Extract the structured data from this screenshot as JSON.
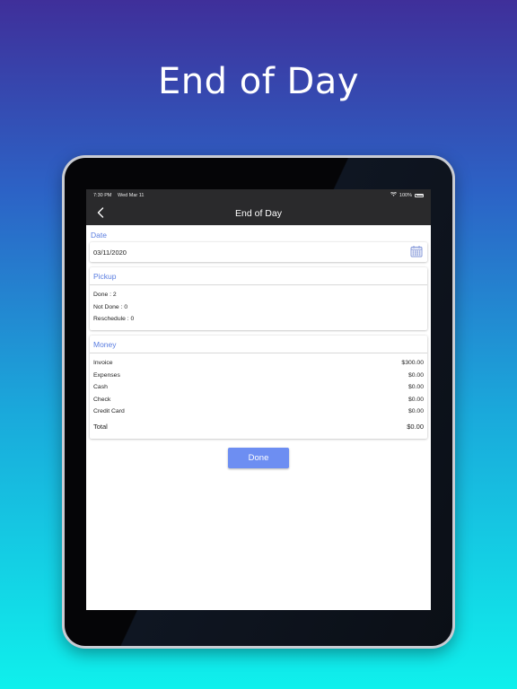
{
  "marketing": {
    "headline": "End of Day"
  },
  "status_bar": {
    "time": "7:30 PM",
    "date": "Wed Mar 11",
    "battery": "100%"
  },
  "nav": {
    "title": "End of Day",
    "back_icon": "chevron-left-icon"
  },
  "date_section": {
    "label": "Date",
    "value": "03/11/2020",
    "icon": "calendar-icon"
  },
  "pickup": {
    "title": "Pickup",
    "items": [
      {
        "text": "Done : 2"
      },
      {
        "text": "Not Done : 0"
      },
      {
        "text": "Reschedule : 0"
      }
    ]
  },
  "money": {
    "title": "Money",
    "rows": [
      {
        "label": "Invoice",
        "value": "$300.00"
      },
      {
        "label": "Expenses",
        "value": "$0.00"
      },
      {
        "label": "Cash",
        "value": "$0.00"
      },
      {
        "label": "Check",
        "value": "$0.00"
      },
      {
        "label": "Credit Card",
        "value": "$0.00"
      }
    ],
    "total": {
      "label": "Total",
      "value": "$0.00"
    }
  },
  "actions": {
    "done_label": "Done"
  },
  "colors": {
    "accent": "#5a7de0",
    "button": "#6d8ef2",
    "nav_background": "#2a2a2c"
  }
}
